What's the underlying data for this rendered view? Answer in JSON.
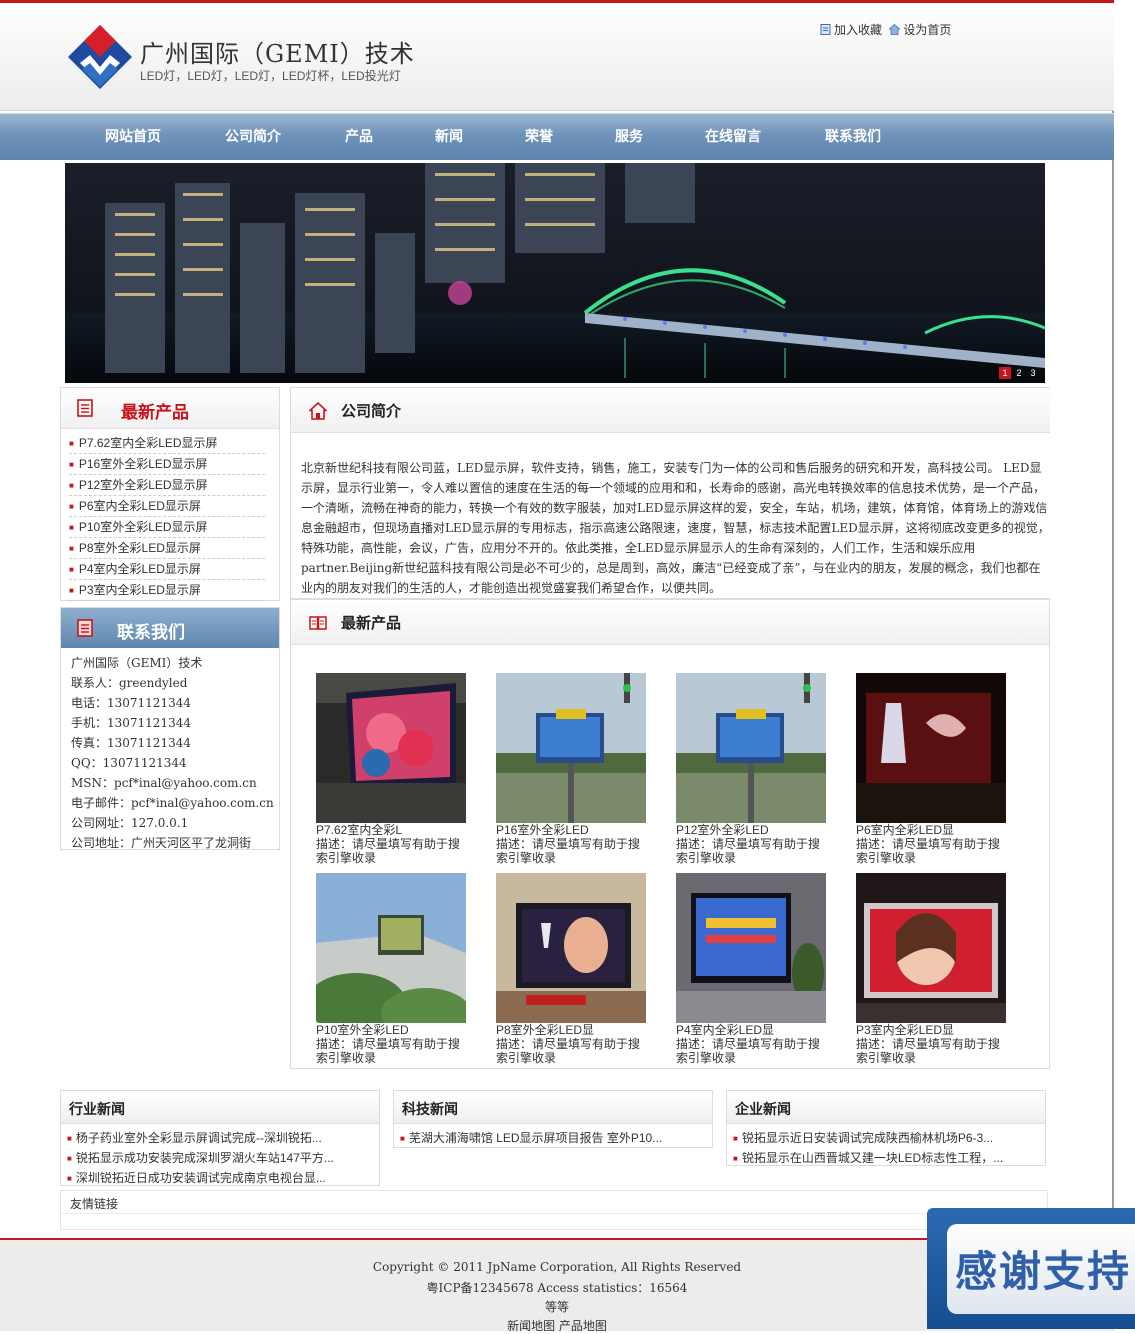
{
  "site": {
    "brand_name": "广州国际（GEMI）技术",
    "brand_tagline": "LED灯，LED灯，LED灯，LED灯杯，LED投光灯",
    "top_links": [
      "加入收藏",
      "设为首页"
    ],
    "accent": "#c8151b",
    "nav_color": "#6f93b9"
  },
  "nav": [
    "网站首页",
    "公司简介",
    "产品",
    "新闻",
    "荣誉",
    "服务",
    "在线留言",
    "联系我们"
  ],
  "banner": {
    "pages": [
      "1",
      "2",
      "3"
    ],
    "active_page": "1"
  },
  "latest_products_sidebar": {
    "title": "最新产品",
    "items": [
      "P7.62室内全彩LED显示屏",
      "P16室外全彩LED显示屏",
      "P12室外全彩LED显示屏",
      "P6室内全彩LED显示屏",
      "P10室外全彩LED显示屏",
      "P8室外全彩LED显示屏",
      "P4室内全彩LED显示屏",
      "P3室内全彩LED显示屏"
    ]
  },
  "contact": {
    "title": "联系我们",
    "lines": [
      "广州国际（GEMI）技术",
      "联系人：greendyled",
      "电话：13071121344",
      "手机：13071121344",
      "传真：13071121344",
      "QQ：13071121344",
      "MSN：pcf*inal@yahoo.com.cn",
      "电子邮件：pcf*inal@yahoo.com.cn",
      "公司网址：127.0.0.1",
      "公司地址：广州天河区平了龙洞街"
    ]
  },
  "about": {
    "title": "公司简介",
    "text": "北京新世纪科技有限公司蓝，LED显示屏，软件支持，销售，施工，安装专门为一体的公司和售后服务的研究和开发，高科技公司。 LED显示屏，显示行业第一，令人难以置信的速度在生活的每一个领域的应用和和，长寿命的感谢，高光电转换效率的信息技术优势，是一个产品，一个清晰，流畅在神奇的能力，转换一个有效的数字服装，加对LED显示屏这样的爱，安全，车站，机场，建筑，体育馆，体育场上的游戏信息金融超市，但现场直播对LED显示屏的专用标志，指示高速公路限速，速度，智慧，标志技术配置LED显示屏，这将彻底改变更多的视觉，特殊功能，高性能，会议，广告，应用分不开的。依此类推，全LED显示屏显示人的生命有深刻的，人们工作，生活和娱乐应用partner.Beijing新世纪蓝科技有限公司是必不可少的，总是周到，高效，廉洁“已经变成了亲”，与在业内的朋友，发展的概念，我们也都在业内的朋友对我们的生活的人，才能创造出视觉盛宴我们希望合作，以便共同。"
  },
  "latest_products": {
    "title": "最新产品",
    "items": [
      {
        "name": "P7.62室内全彩L",
        "desc": "描述：请尽量填写有助于搜索引擎收录"
      },
      {
        "name": "P16室外全彩LED",
        "desc": "描述：请尽量填写有助于搜索引擎收录"
      },
      {
        "name": "P12室外全彩LED",
        "desc": "描述：请尽量填写有助于搜索引擎收录"
      },
      {
        "name": "P6室内全彩LED显",
        "desc": "描述：请尽量填写有助于搜索引擎收录"
      },
      {
        "name": "P10室外全彩LED",
        "desc": "描述：请尽量填写有助于搜索引擎收录"
      },
      {
        "name": "P8室外全彩LED显",
        "desc": "描述：请尽量填写有助于搜索引擎收录"
      },
      {
        "name": "P4室内全彩LED显",
        "desc": "描述：请尽量填写有助于搜索引擎收录"
      },
      {
        "name": "P3室内全彩LED显",
        "desc": "描述：请尽量填写有助于搜索引擎收录"
      }
    ]
  },
  "news": [
    {
      "title": "行业新闻",
      "items": [
        "杨子药业室外全彩显示屏调试完成--深圳锐拓...",
        "锐拓显示成功安装完成深圳罗湖火车站147平方...",
        "深圳锐拓近日成功安装调试完成南京电视台显..."
      ]
    },
    {
      "title": "科技新闻",
      "items": [
        "芜湖大浦海啸馆 LED显示屏项目报告 室外P10..."
      ]
    },
    {
      "title": "企业新闻",
      "items": [
        "锐拓显示近日安装调试完成陕西榆林机场P6-3...",
        "锐拓显示在山西晋城又建一块LED标志性工程，..."
      ]
    }
  ],
  "friend_links": {
    "title": "友情链接"
  },
  "footer": {
    "copyright": "Copyright © 2011 JpName Corporation, All Rights Reserved",
    "icp": "粤ICP备12345678 Access statistics：16564",
    "extra": "等等",
    "links": "新闻地图 产品地图"
  },
  "float_ad": {
    "text": "感谢支持"
  }
}
